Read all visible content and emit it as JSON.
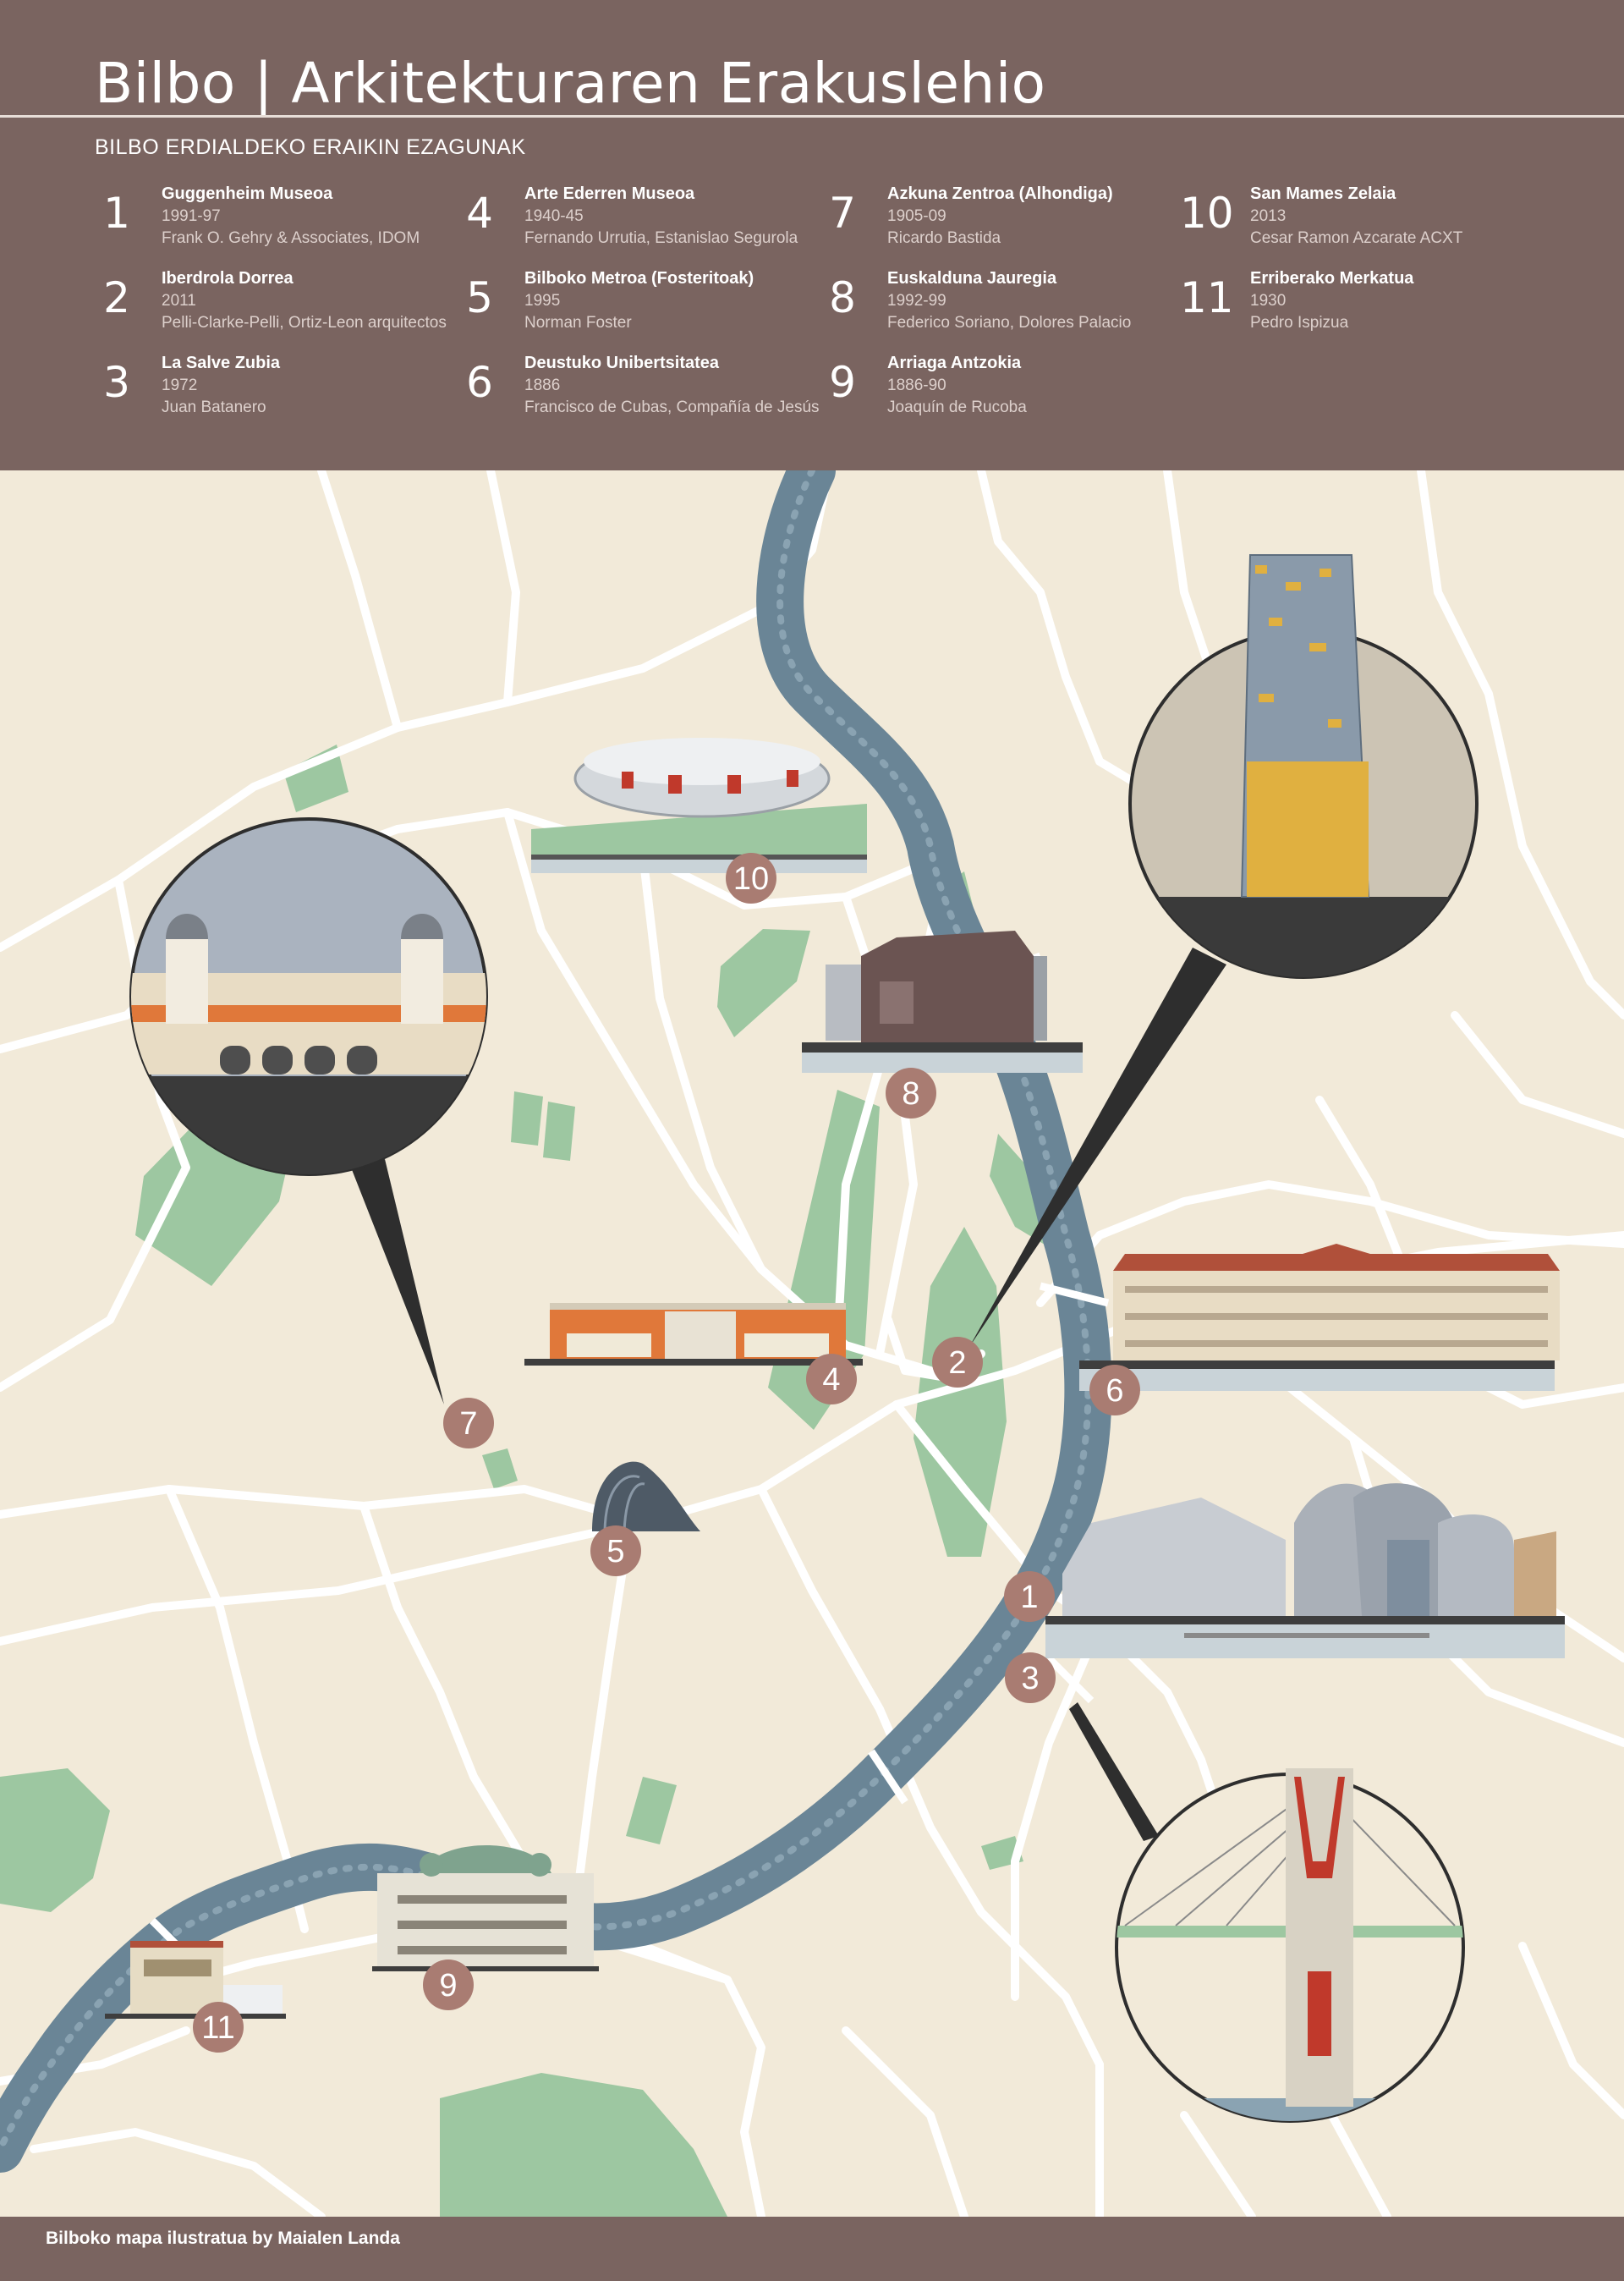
{
  "header": {
    "title": "Bilbo | Arkitekturaren Erakuslehio",
    "subtitle": "BILBO ERDIALDEKO ERAIKIN EZAGUNAK"
  },
  "legend": [
    {
      "num": "1",
      "name": "Guggenheim Museoa",
      "year": "1991-97",
      "architect": "Frank O. Gehry & Associates, IDOM"
    },
    {
      "num": "2",
      "name": "Iberdrola Dorrea",
      "year": "2011",
      "architect": "Pelli-Clarke-Pelli, Ortiz-Leon arquitectos"
    },
    {
      "num": "3",
      "name": "La Salve Zubia",
      "year": "1972",
      "architect": "Juan Batanero"
    },
    {
      "num": "4",
      "name": "Arte Ederren Museoa",
      "year": "1940-45",
      "architect": "Fernando Urrutia, Estanislao Segurola"
    },
    {
      "num": "5",
      "name": "Bilboko Metroa (Fosteritoak)",
      "year": "1995",
      "architect": "Norman Foster"
    },
    {
      "num": "6",
      "name": "Deustuko Unibertsitatea",
      "year": "1886",
      "architect": "Francisco de Cubas, Compañía de Jesús"
    },
    {
      "num": "7",
      "name": "Azkuna Zentroa (Alhondiga)",
      "year": "1905-09",
      "architect": "Ricardo Bastida"
    },
    {
      "num": "8",
      "name": "Euskalduna Jauregia",
      "year": "1992-99",
      "architect": "Federico Soriano, Dolores Palacio"
    },
    {
      "num": "9",
      "name": "Arriaga Antzokia",
      "year": "1886-90",
      "architect": "Joaquín de Rucoba"
    },
    {
      "num": "10",
      "name": "San Mames Zelaia",
      "year": "2013",
      "architect": "Cesar Ramon Azcarate ACXT"
    },
    {
      "num": "11",
      "name": "Erriberako Merkatua",
      "year": "1930",
      "architect": "Pedro Ispizua"
    }
  ],
  "map": {
    "markers": [
      {
        "num": "1"
      },
      {
        "num": "2"
      },
      {
        "num": "3"
      },
      {
        "num": "4"
      },
      {
        "num": "5"
      },
      {
        "num": "6"
      },
      {
        "num": "7"
      },
      {
        "num": "8"
      },
      {
        "num": "9"
      },
      {
        "num": "10"
      },
      {
        "num": "11"
      }
    ]
  },
  "colors": {
    "header": "#7a6460",
    "land": "#f2ead9",
    "river": "#6a8596",
    "park": "#9dc7a1",
    "road": "#ffffff",
    "marker": "#a97c72"
  },
  "footer": {
    "credit": "Bilboko mapa ilustratua by Maialen Landa"
  }
}
